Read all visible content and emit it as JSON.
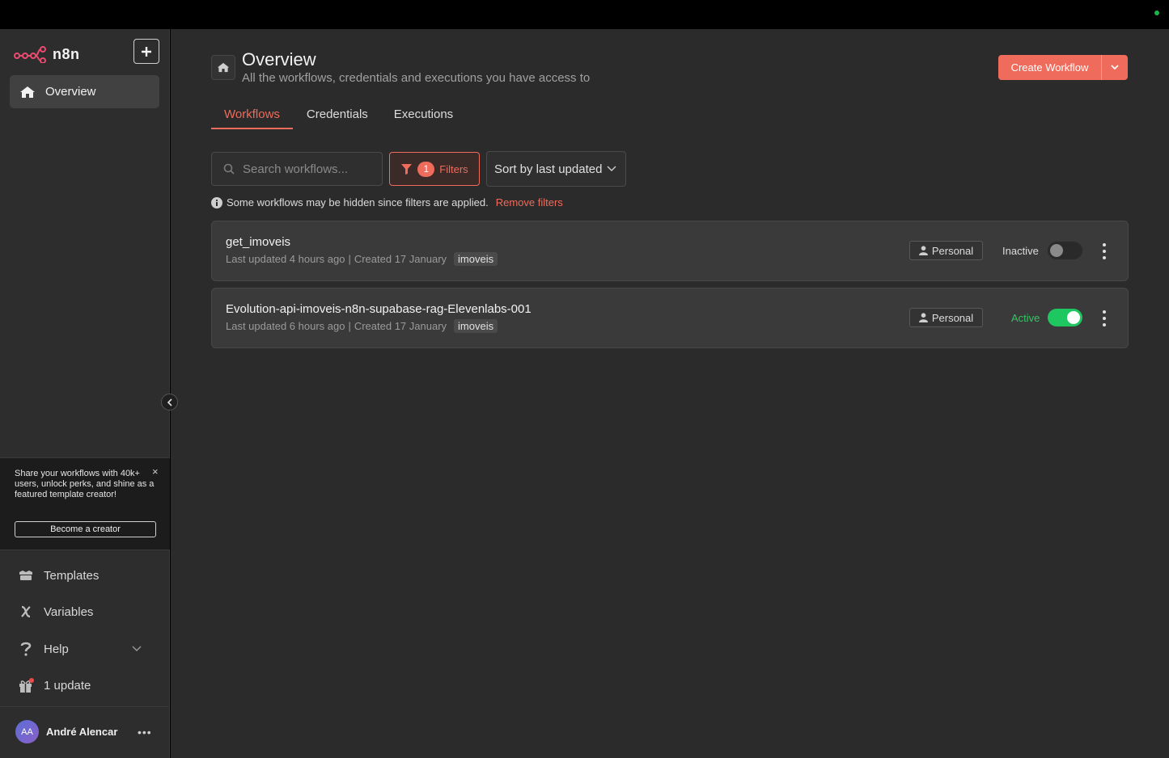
{
  "app": {
    "logo_text": "n8n"
  },
  "sidebar": {
    "overview_label": "Overview",
    "promo": {
      "text": "Share your workflows with 40k+ users, unlock perks, and shine as a featured template creator!",
      "button": "Become a creator",
      "close": "×"
    },
    "items": [
      {
        "label": "Templates",
        "icon": "templates-icon"
      },
      {
        "label": "Variables",
        "icon": "variables-icon"
      },
      {
        "label": "Help",
        "icon": "help-icon"
      },
      {
        "label": "1 update",
        "icon": "gift-icon"
      }
    ],
    "user": {
      "initials": "AA",
      "name": "André Alencar",
      "more": "•••"
    }
  },
  "header": {
    "title": "Overview",
    "subtitle": "All the workflows, credentials and executions you have access to",
    "create_label": "Create Workflow"
  },
  "tabs": [
    {
      "label": "Workflows",
      "active": true
    },
    {
      "label": "Credentials",
      "active": false
    },
    {
      "label": "Executions",
      "active": false
    }
  ],
  "toolbar": {
    "search_placeholder": "Search workflows...",
    "filter_count": "1",
    "filters_label": "Filters",
    "sort_label": "Sort by last updated"
  },
  "notice": {
    "text": "Some workflows may be hidden since filters are applied.",
    "link": "Remove filters"
  },
  "workflows": [
    {
      "name": "get_imoveis",
      "updated": "Last updated 4 hours ago",
      "separator": "|",
      "created": "Created 17 January",
      "tag": "imoveis",
      "owner": "Personal",
      "status": "Inactive",
      "active": false
    },
    {
      "name": "Evolution-api-imoveis-n8n-supabase-rag-Elevenlabs-001",
      "updated": "Last updated 6 hours ago",
      "separator": "|",
      "created": "Created 17 January",
      "tag": "imoveis",
      "owner": "Personal",
      "status": "Active",
      "active": true
    }
  ],
  "colors": {
    "accent": "#ef6b5b",
    "active_green": "#1fc760",
    "background": "#2b2b2b",
    "sidebar": "#2d2d2d"
  }
}
